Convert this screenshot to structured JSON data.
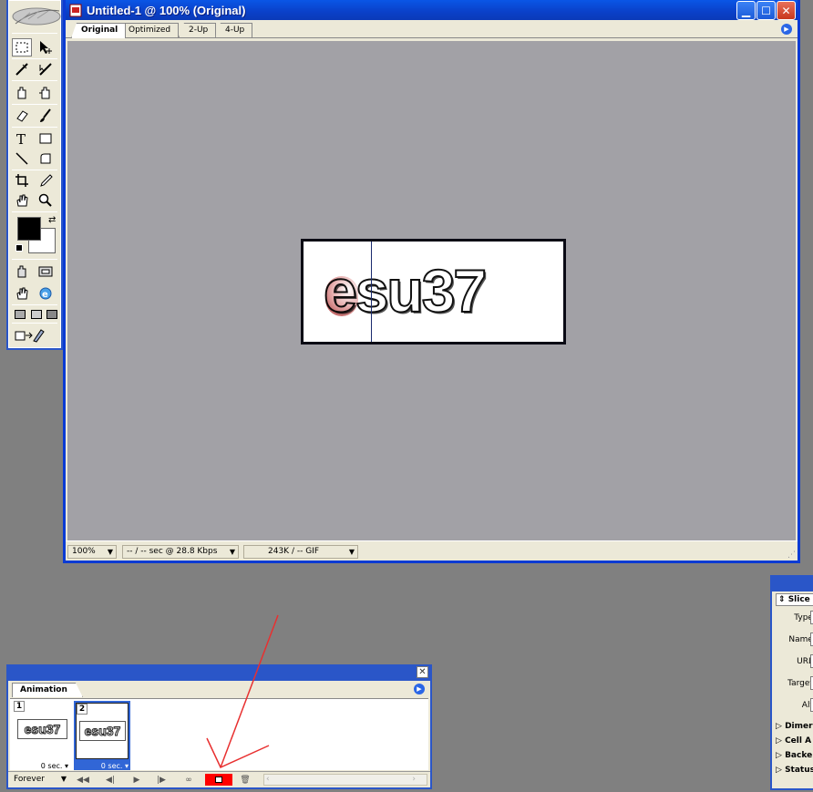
{
  "document_window": {
    "title": "Untitled-1 @ 100% (Original)",
    "tabs": [
      "Original",
      "Optimized",
      "2-Up",
      "4-Up"
    ],
    "active_tab": "Original",
    "canvas_text": "esu37",
    "status": {
      "zoom": "100%",
      "speed": "-- / -- sec @ 28.8 Kbps",
      "size": "243K / -- GIF"
    }
  },
  "animation_panel": {
    "tab": "Animation",
    "frames": [
      {
        "number": "1",
        "delay": "0 sec.",
        "thumb_text": "esu37"
      },
      {
        "number": "2",
        "delay": "0 sec.",
        "thumb_text": "esu37"
      }
    ],
    "loop": "Forever"
  },
  "properties_panel": {
    "header": "Slice",
    "labels": [
      "Type:",
      "Name:",
      "URL:",
      "Target:",
      "Alt:"
    ],
    "sections": [
      "Dimer",
      "Cell A",
      "Backe",
      "Status"
    ]
  },
  "colors": {
    "accent": "#0b3bd3",
    "canvas_bg": "#A2A1A6",
    "workspace_bg": "#808080",
    "panel_bg": "#ECE9D8",
    "highlight": "#FF0000"
  }
}
